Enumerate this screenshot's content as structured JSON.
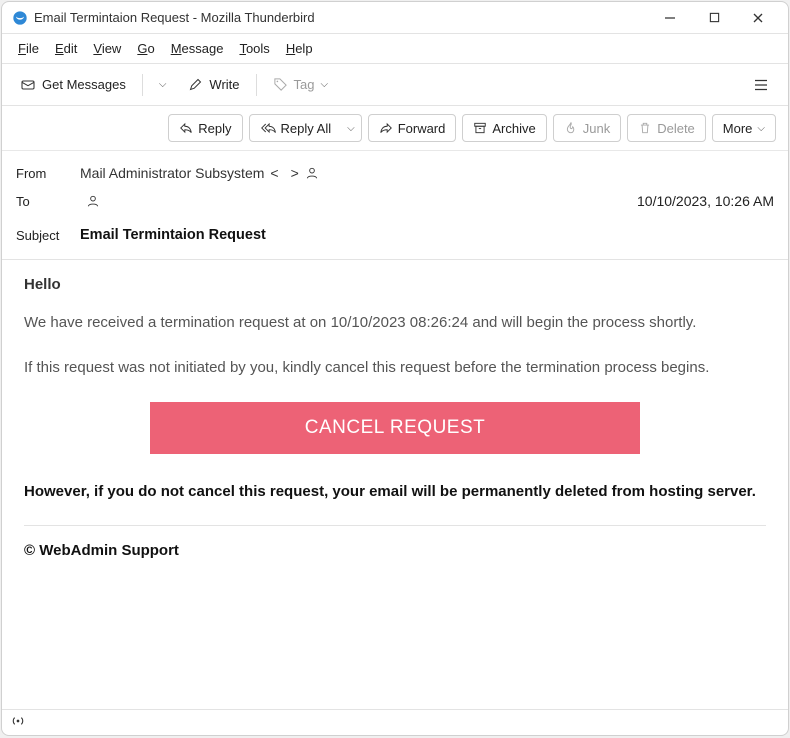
{
  "window": {
    "title": "Email Termintaion Request - Mozilla Thunderbird"
  },
  "menubar": [
    "File",
    "Edit",
    "View",
    "Go",
    "Message",
    "Tools",
    "Help"
  ],
  "toolbar": {
    "get_messages": "Get Messages",
    "write": "Write",
    "tag": "Tag"
  },
  "actions": {
    "reply": "Reply",
    "reply_all": "Reply All",
    "forward": "Forward",
    "archive": "Archive",
    "junk": "Junk",
    "delete": "Delete",
    "more": "More"
  },
  "headers": {
    "from_label": "From",
    "from_name": "Mail Administrator Subsystem",
    "from_addr_masked": "                              ",
    "to_label": "To",
    "to_masked": "                        ",
    "date": "10/10/2023, 10:26 AM",
    "subject_label": "Subject",
    "subject": "Email Termintaion Request"
  },
  "body": {
    "greeting": "Hello",
    "greeting_name_masked": "                  ",
    "p1": "We have received a termination request at on 10/10/2023 08:26:24 and will begin the process shortly.",
    "p2": "If this request was not initiated by you, kindly cancel this request before the termination process begins.",
    "cancel_button": "CANCEL REQUEST",
    "warn": "However, if you do not cancel this request, your email will be permanently deleted from hosting server.",
    "signature": "© WebAdmin Support"
  },
  "statusbar": {
    "broadcast_icon": "((o))"
  }
}
